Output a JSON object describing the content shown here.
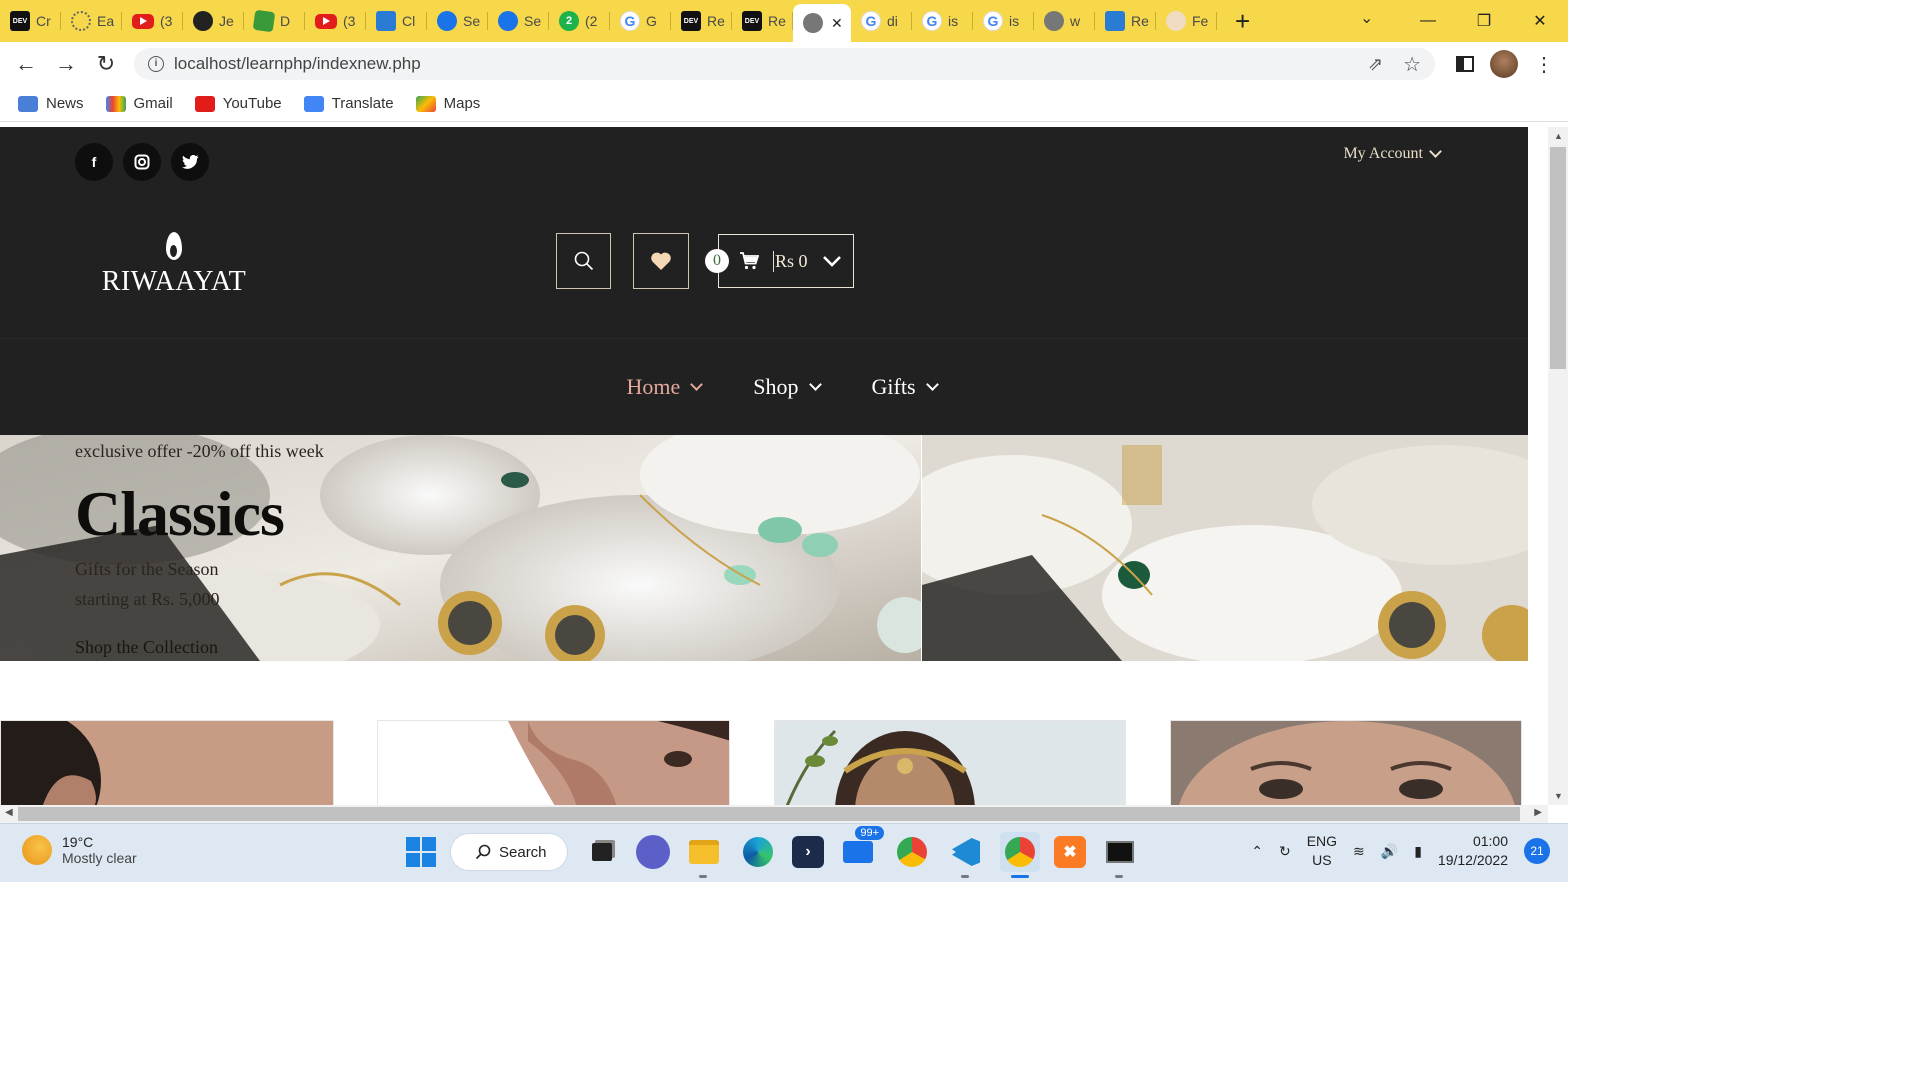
{
  "browser": {
    "tabs": [
      {
        "favicon": "dev-icon",
        "title": "Cr"
      },
      {
        "favicon": "sun-icon",
        "title": "Ea"
      },
      {
        "favicon": "youtube-icon",
        "title": "(3"
      },
      {
        "favicon": "github-icon",
        "title": "Je"
      },
      {
        "favicon": "cube-icon",
        "title": "D"
      },
      {
        "favicon": "youtube-icon",
        "title": "(3"
      },
      {
        "favicon": "app-icon",
        "title": "Cl"
      },
      {
        "favicon": "gear-icon",
        "title": "Se"
      },
      {
        "favicon": "gear-icon",
        "title": "Se"
      },
      {
        "favicon": "whatsapp-icon",
        "title": "(2"
      },
      {
        "favicon": "google-icon",
        "title": "G"
      },
      {
        "favicon": "dev-icon",
        "title": "Re"
      },
      {
        "favicon": "dev-icon",
        "title": "Re"
      },
      {
        "favicon": "globe-icon",
        "title": "",
        "active": true
      },
      {
        "favicon": "google-icon",
        "title": "di"
      },
      {
        "favicon": "google-icon",
        "title": "is"
      },
      {
        "favicon": "google-icon",
        "title": "is"
      },
      {
        "favicon": "globe-icon",
        "title": "w"
      },
      {
        "favicon": "app-icon",
        "title": "Re"
      },
      {
        "favicon": "flower-icon",
        "title": "Fe"
      }
    ],
    "fav_letters": {
      "dev": "DEV",
      "whatsapp": "2",
      "google": "G"
    },
    "url": "localhost/learnphp/indexnew.php",
    "bookmarks": [
      "News",
      "Gmail",
      "YouTube",
      "Translate",
      "Maps"
    ]
  },
  "site": {
    "account_label": "My Account",
    "logo_text": "RIWAAYAT",
    "cart_count": "0",
    "cart_total": "Rs 0",
    "nav": [
      "Home",
      "Shop",
      "Gifts"
    ],
    "social": [
      "f",
      "ig",
      "tw"
    ],
    "hero": {
      "offer": "exclusive offer -20% off this week",
      "title": "Classics",
      "sub1": "Gifts for the Season",
      "sub2": "starting at Rs. 5,000",
      "cta": "Shop the Collection"
    }
  },
  "taskbar": {
    "temp": "19°C",
    "weather": "Mostly clear",
    "search_label": "Search",
    "mail_badge": "99+",
    "lang1": "ENG",
    "lang2": "US",
    "time": "01:00",
    "date": "19/12/2022",
    "notifications": "21"
  },
  "colors": {
    "tabbar": "#f6d84a",
    "header_bg": "#212121",
    "nav_active": "#e3a79c",
    "accent_blue": "#1a73e8"
  }
}
